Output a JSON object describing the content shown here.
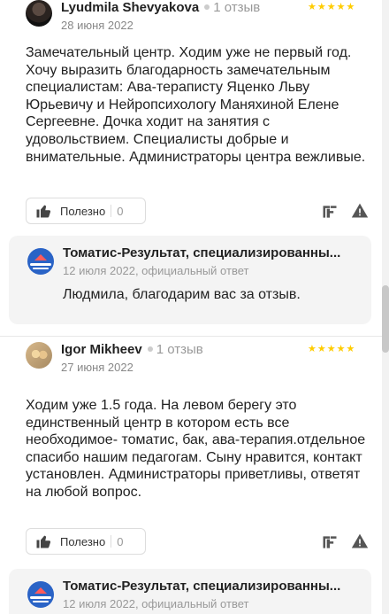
{
  "reviews": [
    {
      "author": "Lyudmila Shevyakova",
      "review_count": "1 отзыв",
      "date": "28 июня 2022",
      "rating": 5,
      "stars_text": "★★★★★",
      "text": "Замечательный центр. Ходим уже не первый год. Хочу выразить благодарность замечательным специалистам: Ава-тераписту Яценко Льву Юрьевичу и Нейропсихологу Маняхиной Елене Сергеевне. Дочка ходит на занятия с удовольствием. Специалисты добрые и внимательные. Администраторы центра вежливые.",
      "useful_label": "Полезно",
      "useful_count": "0",
      "reply": {
        "org_name": "Томатис-Результат, специализированны...",
        "meta": "12 июля 2022, официальный ответ",
        "text": "Людмила, благодарим вас за отзыв."
      }
    },
    {
      "author": "Igor Mikheev",
      "review_count": "1 отзыв",
      "date": "27 июня 2022",
      "rating": 5,
      "stars_text": "★★★★★",
      "text": "Ходим уже 1.5 года. На левом берегу это единственный центр в котором есть все необходимое- томатис, бак, ава-терапия.отдельное спасибо нашим педагогам. Сыну нравится, контакт установлен. Администраторы приветливы, ответят на любой вопрос.",
      "useful_label": "Полезно",
      "useful_count": "0",
      "reply": {
        "org_name": "Томатис-Результат, специализированны...",
        "meta": "12 июля 2022, официальный ответ",
        "text": ""
      }
    }
  ],
  "icons": {
    "useful": "thumb-up-icon",
    "share": "share-icon",
    "report": "warning-icon"
  },
  "colors": {
    "star": "#ffcc00",
    "org_logo": "#2a63c6",
    "reply_bg": "#f4f4f4"
  }
}
